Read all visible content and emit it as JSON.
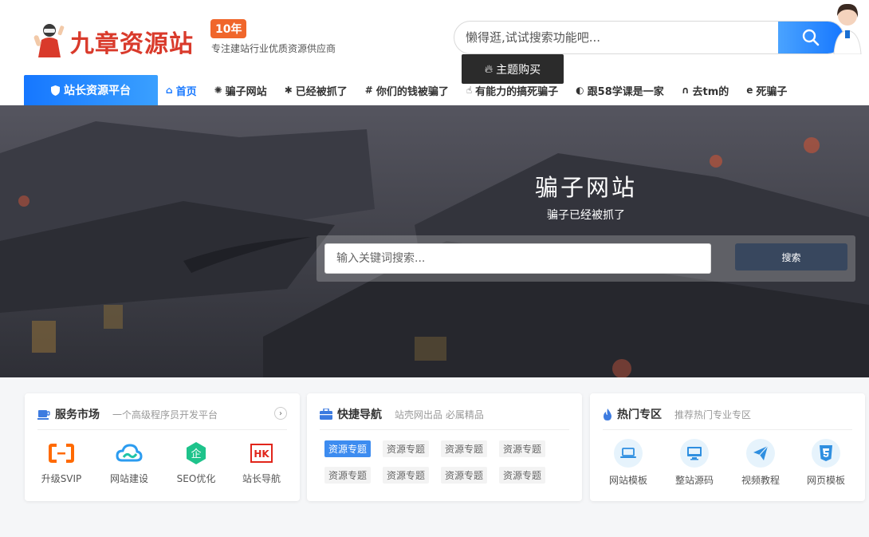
{
  "header": {
    "logo_text": "九章资源站",
    "badge": "10年",
    "slogan": "专注建站行业优质资源供应商",
    "search_placeholder": "懒得逛,试试搜索功能吧...",
    "tooltip": "主题购买"
  },
  "nav": {
    "platform": "站长资源平台",
    "items": [
      {
        "label": "首页",
        "icon": "home-icon"
      },
      {
        "label": "骗子网站",
        "icon": "bug-icon"
      },
      {
        "label": "已经被抓了",
        "icon": "asterisk-icon"
      },
      {
        "label": "你们的钱被骗了",
        "icon": "hashtag-icon"
      },
      {
        "label": "有能力的搞死骗子",
        "icon": "thumbs-up-icon"
      },
      {
        "label": "跟58学课是一家",
        "icon": "pacman-icon"
      },
      {
        "label": "去tm的",
        "icon": "headphones-icon"
      },
      {
        "label": "死骗子",
        "icon": "ie-icon"
      }
    ]
  },
  "hero": {
    "title": "骗子网站",
    "subtitle": "骗子已经被抓了",
    "search_placeholder": "输入关键词搜索...",
    "search_button": "搜索"
  },
  "cards": {
    "services": {
      "title": "服务市场",
      "subtitle": "一个高级程序员开发平台",
      "items": [
        {
          "label": "升级SVIP",
          "icon": "aliyun-icon"
        },
        {
          "label": "网站建设",
          "icon": "cloud-icon"
        },
        {
          "label": "SEO优化",
          "icon": "enterprise-icon"
        },
        {
          "label": "站长导航",
          "icon": "hk-icon"
        }
      ]
    },
    "quick_nav": {
      "title": "快捷导航",
      "subtitle": "站壳网出品 必属精品",
      "tags": [
        "资源专题",
        "资源专题",
        "资源专题",
        "资源专题",
        "资源专题",
        "资源专题",
        "资源专题",
        "资源专题"
      ]
    },
    "hot": {
      "title": "热门专区",
      "subtitle": "推荐热门专业专区",
      "items": [
        {
          "label": "网站模板",
          "icon": "laptop-icon"
        },
        {
          "label": "整站源码",
          "icon": "desktop-icon"
        },
        {
          "label": "视频教程",
          "icon": "paper-plane-icon"
        },
        {
          "label": "网页模板",
          "icon": "html5-icon"
        }
      ]
    }
  },
  "colors": {
    "brand": "#1677ff",
    "logo": "#d93a2b",
    "badge": "#f0662b",
    "hero_button": "#38475e"
  }
}
